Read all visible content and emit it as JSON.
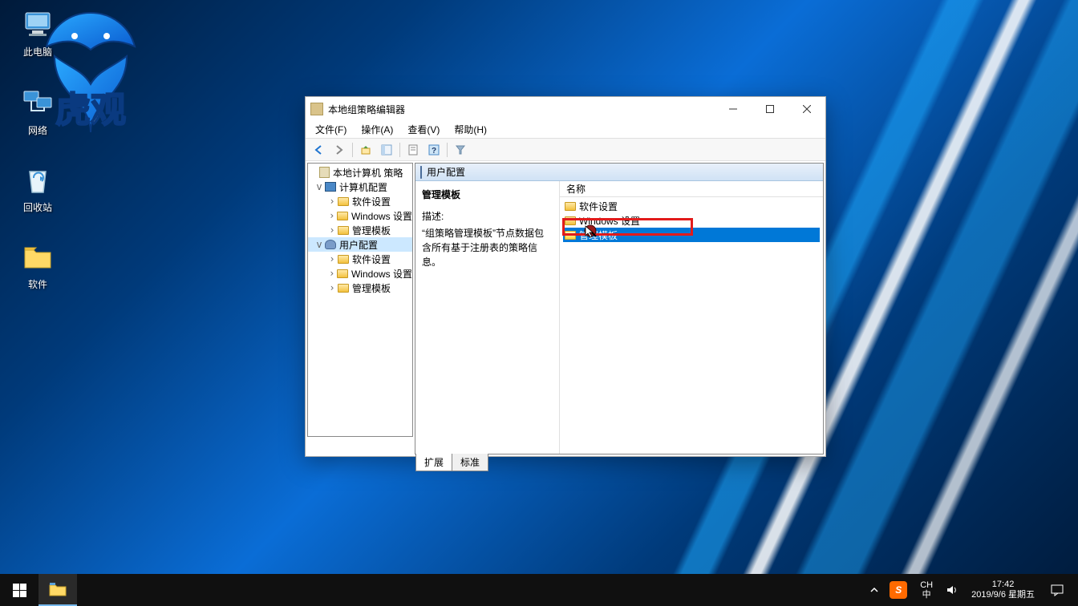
{
  "desktop_icons": {
    "this_pc": "此电脑",
    "network": "网络",
    "recycle_bin": "回收站",
    "software": "软件"
  },
  "watermark_text": "虎观",
  "window": {
    "title": "本地组策略编辑器",
    "menus": {
      "file": "文件(F)",
      "action": "操作(A)",
      "view": "查看(V)",
      "help": "帮助(H)"
    },
    "tree": {
      "root": "本地计算机 策略",
      "computer_config": "计算机配置",
      "user_config": "用户配置",
      "software_settings": "软件设置",
      "windows_settings": "Windows 设置",
      "admin_templates": "管理模板"
    },
    "content": {
      "header": "用户配置",
      "heading": "管理模板",
      "desc_label": "描述:",
      "desc": "“组策略管理模板”节点数据包含所有基于注册表的策略信息。",
      "col_name": "名称",
      "items": {
        "software_settings": "软件设置",
        "windows_settings": "Windows 设置",
        "admin_templates": "管理模板"
      },
      "tabs": {
        "extended": "扩展",
        "standard": "标准"
      }
    }
  },
  "taskbar": {
    "ime_lang": "CH",
    "ime_kbd": "中",
    "time": "17:42",
    "date": "2019/9/6 星期五"
  }
}
